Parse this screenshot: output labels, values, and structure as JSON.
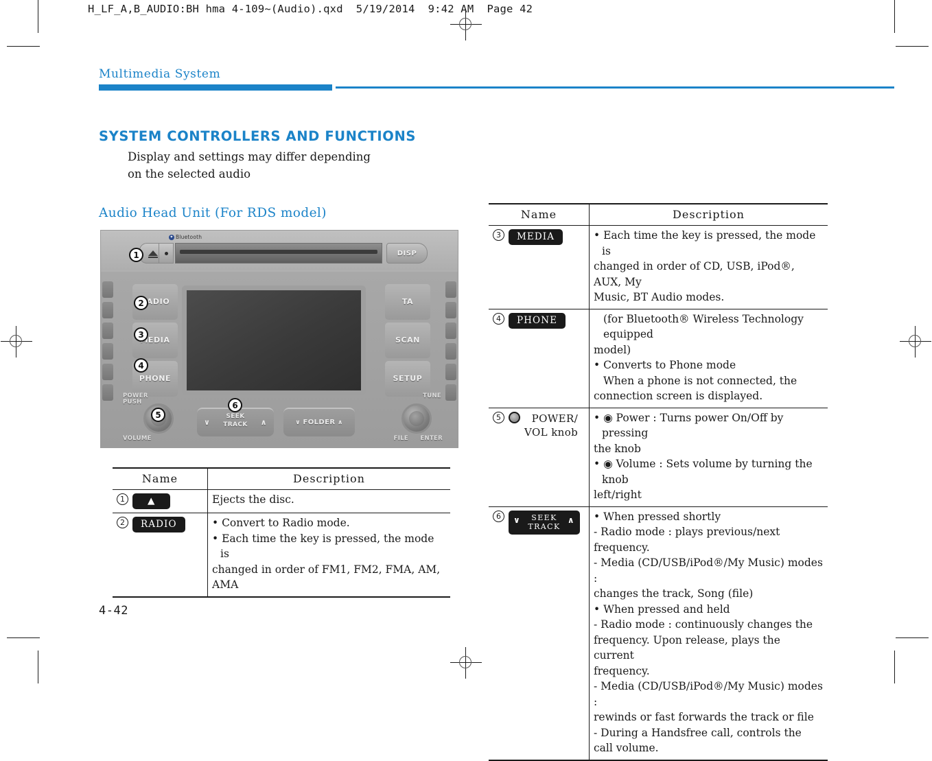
{
  "print": {
    "file_header": "H_LF_A,B_AUDIO:BH hma 4-109~(Audio).qxd  5/19/2014  9:42 AM  Page 42",
    "folio": "4-42"
  },
  "colors": {
    "accent_blue": "#1b83c8",
    "ink": "#1a1a1a"
  },
  "running_head": "Multimedia System",
  "section": {
    "title": "SYSTEM CONTROLLERS AND FUNCTIONS",
    "note_line1": "Display and settings may differ depending",
    "note_line2": "on the selected audio",
    "subhead": "Audio Head Unit (For RDS model)"
  },
  "headunit": {
    "brand_mark": "Bluetooth",
    "disp_label": "DISP",
    "left_keys": [
      "RADIO",
      "MEDIA",
      "PHONE"
    ],
    "right_keys": [
      "TA",
      "SCAN",
      "SETUP"
    ],
    "power_label_line1": "POWER",
    "power_label_line2": "PUSH",
    "volume_label": "VOLUME",
    "tune_label": "TUNE",
    "file_label": "FILE",
    "enter_label": "ENTER",
    "seek_label_line1": "SEEK",
    "seek_label_line2": "TRACK",
    "folder_label": "FOLDER",
    "callouts": [
      "1",
      "2",
      "3",
      "4",
      "5",
      "6"
    ]
  },
  "table_headers": {
    "name": "Name",
    "description": "Description"
  },
  "table_left": {
    "rows": [
      {
        "num": "1",
        "badge_kind": "eject",
        "badge_label": "",
        "desc_lines": [
          "Ejects the disc."
        ]
      },
      {
        "num": "2",
        "badge_kind": "text",
        "badge_label": "RADIO",
        "desc_lines": [
          "• Convert to Radio mode.",
          "• Each time the key is pressed, the mode is",
          "changed in order of FM1, FM2, FMA, AM, AMA"
        ]
      }
    ]
  },
  "table_right": {
    "rows": [
      {
        "num": "3",
        "badge_kind": "text",
        "badge_label": "MEDIA",
        "desc_lines": [
          "• Each time the key is pressed, the mode is",
          "changed in order of CD, USB, iPod®, AUX, My",
          "Music, BT Audio modes."
        ]
      },
      {
        "num": "4",
        "badge_kind": "text",
        "badge_label": "PHONE",
        "desc_lines": [
          "(for Bluetooth® Wireless Technology equipped",
          "model)",
          "• Converts to Phone mode",
          "When a phone is not connected, the",
          "connection screen is displayed."
        ]
      },
      {
        "num": "5",
        "badge_kind": "knob",
        "badge_label": "POWER/",
        "badge_label2": "VOL knob",
        "desc_lines": [
          "• ◉ Power : Turns power On/Off by pressing",
          "the knob",
          "• ◉ Volume : Sets volume by turning the knob",
          "left/right"
        ]
      },
      {
        "num": "6",
        "badge_kind": "seek",
        "badge_label": "SEEK",
        "badge_label2": "TRACK",
        "desc_lines": [
          "• When pressed shortly",
          "- Radio mode : plays previous/next frequency.",
          "- Media (CD/USB/iPod®/My Music) modes :",
          "changes the track, Song (file)",
          "• When pressed and held",
          "- Radio mode : continuously changes the",
          "frequency. Upon release, plays the current",
          "frequency.",
          "- Media (CD/USB/iPod®/My Music) modes :",
          "rewinds or fast forwards the track or file",
          "- During a Handsfree call, controls the call volume."
        ]
      }
    ]
  }
}
